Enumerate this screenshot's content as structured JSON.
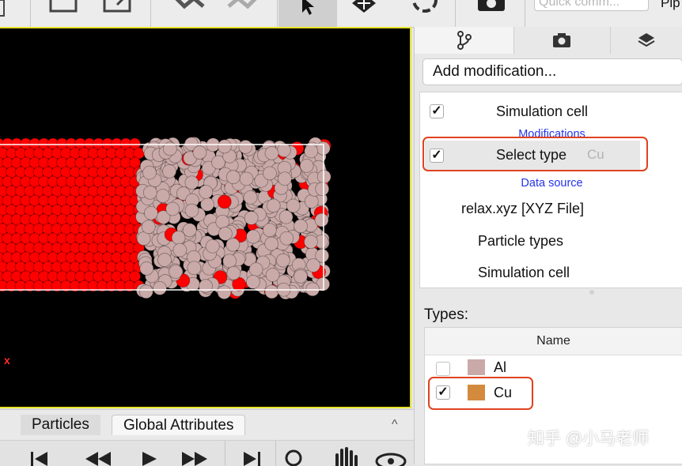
{
  "toolbar": {
    "quick_command_placeholder": "Quick comm...",
    "pipeline_label": "Pip",
    "icons": [
      "new-icon",
      "export-icon",
      "undo-icon",
      "redo-icon",
      "select-cursor-icon",
      "pan-icon",
      "orbit-icon",
      "screenshot-icon"
    ]
  },
  "viewport": {
    "axis_label": "x",
    "atom_colors": {
      "cu": "#ff0000",
      "al": "#c9aaa8"
    }
  },
  "bottom": {
    "tabs": [
      "Particles",
      "Global Attributes"
    ],
    "collapse_glyph": "^"
  },
  "right_panel": {
    "tabs": [
      "pipeline-icon",
      "camera-icon",
      "layers-icon"
    ],
    "add_modification": "Add modification...",
    "pipeline_items": {
      "simulation_cell_top": "Simulation cell",
      "modifications_header": "Modifications",
      "select_type_label": "Select type",
      "select_type_sub": "Cu",
      "data_source_header": "Data source",
      "source_file": "relax.xyz [XYZ File]",
      "particle_types": "Particle types",
      "simulation_cell_bottom": "Simulation cell"
    },
    "checkmark": "✓",
    "types_label": "Types:",
    "types_column": "Name",
    "types": [
      {
        "name": "Al",
        "color": "#c9aaa8",
        "checked": false
      },
      {
        "name": "Cu",
        "color": "#d48a3c",
        "checked": true
      }
    ],
    "watermark": "知乎 @小马老师"
  },
  "highlight_color": "#e0421f"
}
